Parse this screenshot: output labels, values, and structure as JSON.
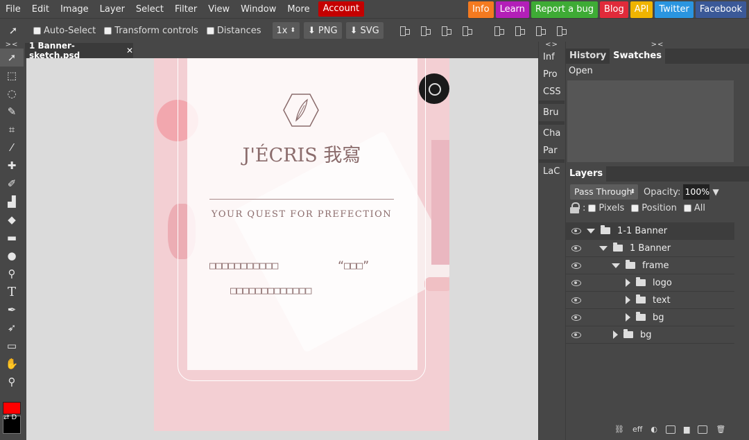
{
  "menu": {
    "items": [
      "File",
      "Edit",
      "Image",
      "Layer",
      "Select",
      "Filter",
      "View",
      "Window",
      "More"
    ],
    "account": "Account"
  },
  "social": [
    {
      "label": "Info",
      "color": "#f47a20"
    },
    {
      "label": "Learn",
      "color": "#b31fb8"
    },
    {
      "label": "Report a bug",
      "color": "#3eab35"
    },
    {
      "label": "Blog",
      "color": "#e02a3a"
    },
    {
      "label": "API",
      "color": "#f0b400"
    },
    {
      "label": "Twitter",
      "color": "#2a95e0"
    },
    {
      "label": "Facebook",
      "color": "#3b5998"
    }
  ],
  "options": {
    "auto_select": "Auto-Select",
    "transform_controls": "Transform controls",
    "distances": "Distances",
    "zoom": "1x",
    "png": "PNG",
    "svg": "SVG"
  },
  "document": {
    "tab_name": "1 Banner-sketch.psd",
    "close": "✕"
  },
  "artboard": {
    "brand": "J'ÉCRIS 我寫",
    "tagline": "YOUR QUEST FOR PREFECTION",
    "placeholder_line1": "□□□□□□□□□□□",
    "placeholder_quote": "“□□□”",
    "placeholder_line2": "□□□□□□□□□□□□□"
  },
  "mid_panel": [
    "Inf",
    "Pro",
    "CSS",
    "Bru",
    "Cha",
    "Par",
    "LaC"
  ],
  "history": {
    "tabs": [
      "History",
      "Swatches"
    ],
    "rows": [
      "Open"
    ]
  },
  "layers_panel": {
    "title": "Layers",
    "blend_mode": "Pass Through",
    "opacity_label": "Opacity:",
    "opacity_value": "100%",
    "lock_pixels": "Pixels",
    "lock_position": "Position",
    "lock_all": "All",
    "footer_eff": "eff",
    "layers": [
      {
        "name": "1-1 Banner",
        "indent": 0,
        "expanded": true
      },
      {
        "name": "1 Banner",
        "indent": 1,
        "expanded": true
      },
      {
        "name": "frame",
        "indent": 2,
        "expanded": true
      },
      {
        "name": "logo",
        "indent": 3,
        "expanded": false
      },
      {
        "name": "text",
        "indent": 3,
        "expanded": false
      },
      {
        "name": "bg",
        "indent": 3,
        "expanded": false
      },
      {
        "name": "bg",
        "indent": 1,
        "expanded": false
      }
    ]
  },
  "colors": {
    "foreground": "#ff0000",
    "background": "#000000",
    "labels": "⇄ D"
  }
}
